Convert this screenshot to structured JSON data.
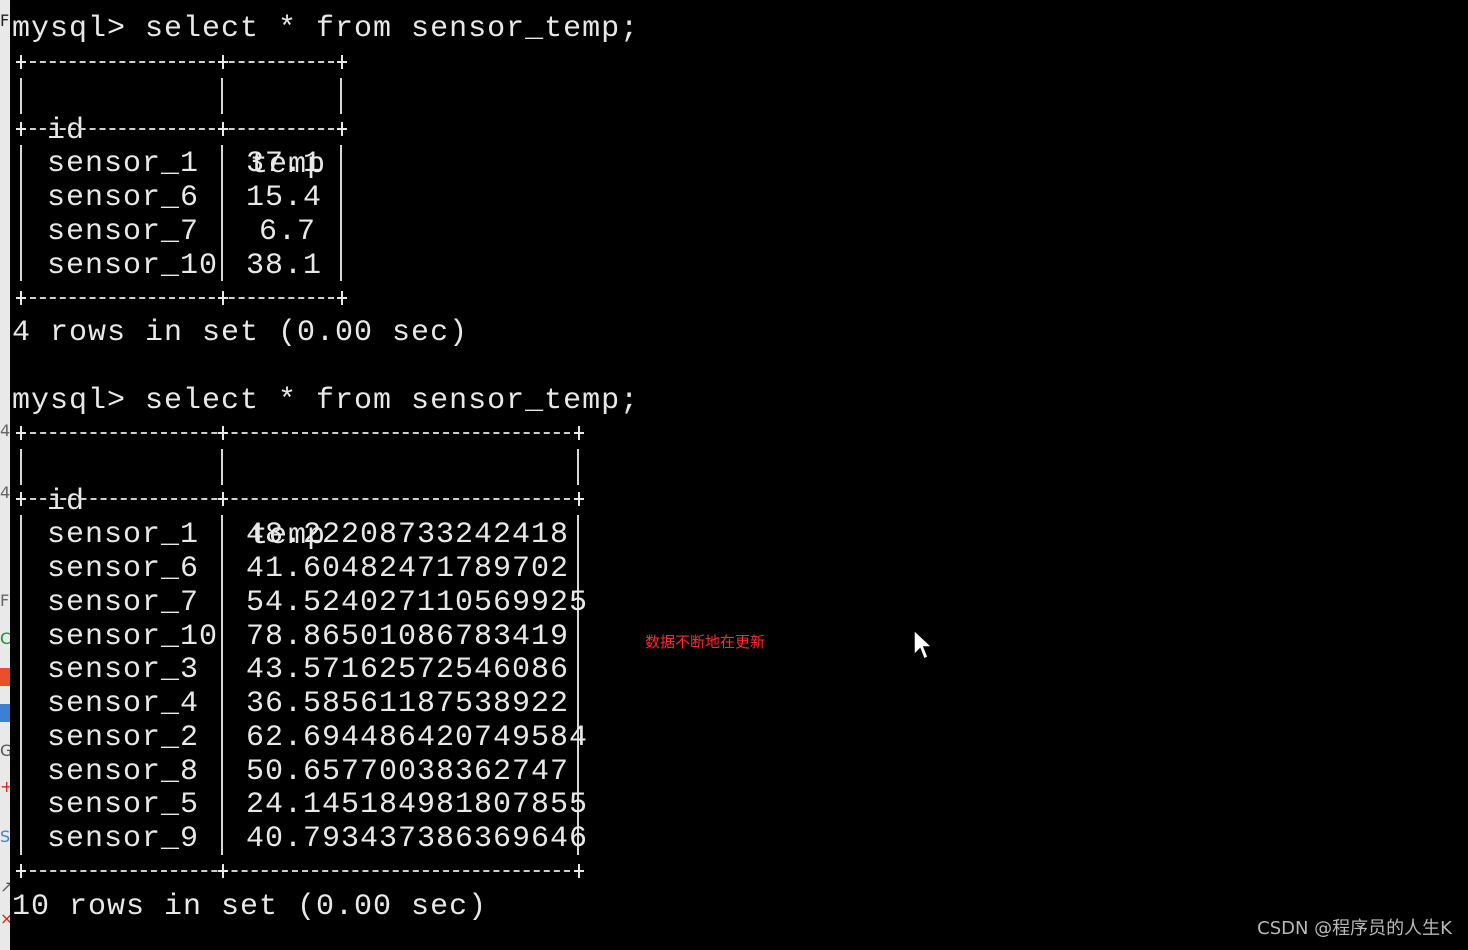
{
  "side_strip_marks": [
    "F",
    "4",
    "4",
    "F",
    "C",
    "",
    "",
    "G",
    "+",
    "S",
    "↗",
    "×"
  ],
  "queries": [
    {
      "prompt": "mysql> select * from sensor_temp;",
      "columns": [
        "id",
        "temp"
      ],
      "rows": [
        {
          "id": "sensor_1",
          "temp": "37.1"
        },
        {
          "id": "sensor_6",
          "temp": "15.4"
        },
        {
          "id": "sensor_7",
          "temp": "6.7"
        },
        {
          "id": "sensor_10",
          "temp": "38.1"
        }
      ],
      "footer": "4 rows in set (0.00 sec)"
    },
    {
      "prompt": "mysql> select * from sensor_temp;",
      "columns": [
        "id",
        "temp"
      ],
      "rows": [
        {
          "id": "sensor_1",
          "temp": "48.22208733242418"
        },
        {
          "id": "sensor_6",
          "temp": "41.60482471789702"
        },
        {
          "id": "sensor_7",
          "temp": "54.524027110569925"
        },
        {
          "id": "sensor_10",
          "temp": "78.86501086783419"
        },
        {
          "id": "sensor_3",
          "temp": "43.57162572546086"
        },
        {
          "id": "sensor_4",
          "temp": "36.58561187538922"
        },
        {
          "id": "sensor_2",
          "temp": "62.694486420749584"
        },
        {
          "id": "sensor_8",
          "temp": "50.65770038362747"
        },
        {
          "id": "sensor_5",
          "temp": "24.145184981807855"
        },
        {
          "id": "sensor_9",
          "temp": "40.793437386369646"
        }
      ],
      "footer": "10 rows in set (0.00 sec)"
    }
  ],
  "annotation": "数据不断地在更新",
  "watermark": "CSDN @程序员的人生K",
  "colors": {
    "background": "#000000",
    "terminal_text": "#e8e8e8",
    "annotation": "#ff2a2a",
    "left_strip": "#e9e9e9"
  },
  "icons": {
    "cursor": "mouse-pointer-icon"
  }
}
